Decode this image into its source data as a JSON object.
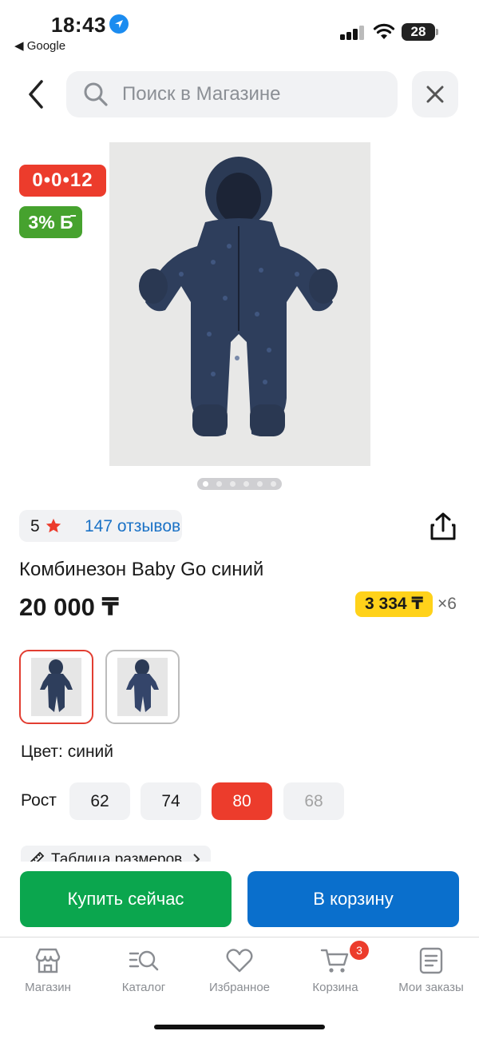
{
  "status_bar": {
    "time": "18:43",
    "back_app": "◀ Google",
    "battery": "28"
  },
  "search": {
    "placeholder": "Поиск в Магазине"
  },
  "badges": {
    "timer": "0•0•12",
    "bonus": "3% Б̄"
  },
  "gallery": {
    "image_count": 6,
    "active_index": 0
  },
  "rating": {
    "score": "5",
    "reviews": "147 отзывов"
  },
  "product": {
    "title": "Комбинезон Baby Go синий",
    "price": "20 000 ₸",
    "installment_price": "3 334 ₸",
    "installment_multiplier": "×6",
    "color_label": "Цвет: синий",
    "size_label": "Рост",
    "sizes": [
      "62",
      "74",
      "80",
      "68"
    ],
    "selected_size": "80",
    "unavailable_size": "68",
    "size_table": "Таблица размеров"
  },
  "actions": {
    "buy_now": "Купить сейчас",
    "add_to_cart": "В корзину"
  },
  "tabbar": {
    "items": [
      {
        "label": "Магазин",
        "icon": "store-icon"
      },
      {
        "label": "Каталог",
        "icon": "catalog-search-icon"
      },
      {
        "label": "Избранное",
        "icon": "heart-icon"
      },
      {
        "label": "Корзина",
        "icon": "cart-icon"
      },
      {
        "label": "Мои заказы",
        "icon": "orders-icon"
      }
    ],
    "cart_count": "3"
  },
  "colors": {
    "accent_red": "#ec3c2c",
    "bonus_green": "#46a22e",
    "buy_green": "#0ba64e",
    "cart_blue": "#0a6fcc",
    "installment_yellow": "#ffd21a",
    "link_blue": "#1b72c6"
  }
}
